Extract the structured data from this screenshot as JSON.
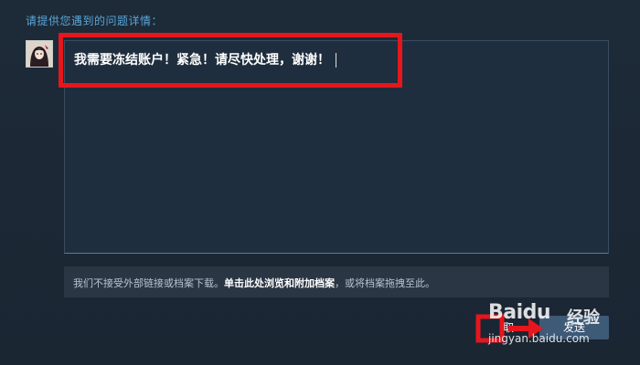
{
  "form": {
    "section_label": "请提供您遇到的问题详情：",
    "message_text": "我需要冻结账户！紧急！请尽快处理，谢谢！"
  },
  "attachment": {
    "prefix": "我们不接受外部链接或档案下载。",
    "link": "单击此处浏览和附加档案",
    "suffix": "，或将档案拖拽至此。"
  },
  "actions": {
    "cancel_label": "取",
    "submit_label": "发送"
  },
  "watermark": {
    "brand": "Baidu",
    "brand_cn": "经验",
    "url": "jingyan.baidu.com"
  },
  "colors": {
    "background": "#1b2838",
    "label_blue": "#5aa6d8",
    "highlight_red": "#e6161c",
    "field_border_active": "#4e7db8"
  }
}
